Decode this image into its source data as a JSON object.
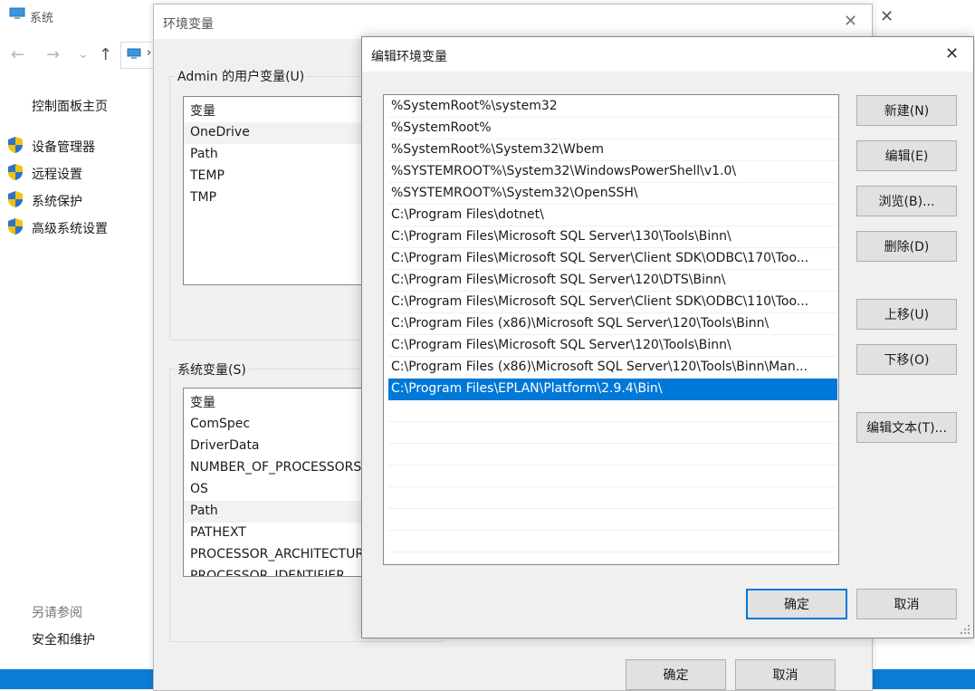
{
  "system_window": {
    "title": "系统",
    "control_panel_home": "控制面板主页",
    "links": [
      "设备管理器",
      "远程设置",
      "系统保护",
      "高级系统设置"
    ],
    "see_also": "另请参阅",
    "security_maintenance": "安全和维护",
    "nav_back": "←",
    "nav_forward": "→",
    "nav_recent": "⌄",
    "nav_up": "↑",
    "address_chevron": "›",
    "close_symbol": "✕"
  },
  "env_dialog": {
    "title": "环境变量",
    "close_symbol": "✕",
    "user_vars_label": "Admin 的用户变量(U)",
    "user_vars_header": "变量",
    "user_vars": [
      "OneDrive",
      "Path",
      "TEMP",
      "TMP"
    ],
    "system_vars_label": "系统变量(S)",
    "system_vars_header": "变量",
    "system_vars": [
      "ComSpec",
      "DriverData",
      "NUMBER_OF_PROCESSORS",
      "OS",
      "Path",
      "PATHEXT",
      "PROCESSOR_ARCHITECTURE",
      "PROCESSOR_IDENTIFIER"
    ],
    "ok_label": "确定",
    "cancel_label": "取消"
  },
  "edit_dialog": {
    "title": "编辑环境变量",
    "close_symbol": "✕",
    "paths": [
      "%SystemRoot%\\system32",
      "%SystemRoot%",
      "%SystemRoot%\\System32\\Wbem",
      "%SYSTEMROOT%\\System32\\WindowsPowerShell\\v1.0\\",
      "%SYSTEMROOT%\\System32\\OpenSSH\\",
      "C:\\Program Files\\dotnet\\",
      "C:\\Program Files\\Microsoft SQL Server\\130\\Tools\\Binn\\",
      "C:\\Program Files\\Microsoft SQL Server\\Client SDK\\ODBC\\170\\Too...",
      "C:\\Program Files\\Microsoft SQL Server\\120\\DTS\\Binn\\",
      "C:\\Program Files\\Microsoft SQL Server\\Client SDK\\ODBC\\110\\Too...",
      "C:\\Program Files (x86)\\Microsoft SQL Server\\120\\Tools\\Binn\\",
      "C:\\Program Files\\Microsoft SQL Server\\120\\Tools\\Binn\\",
      "C:\\Program Files (x86)\\Microsoft SQL Server\\120\\Tools\\Binn\\Man...",
      "C:\\Program Files\\EPLAN\\Platform\\2.9.4\\Bin\\"
    ],
    "selected_index": 13,
    "buttons": {
      "new": "新建(N)",
      "edit": "编辑(E)",
      "browse": "浏览(B)...",
      "delete": "删除(D)",
      "move_up": "上移(U)",
      "move_down": "下移(O)",
      "edit_text": "编辑文本(T)..."
    },
    "ok_label": "确定",
    "cancel_label": "取消"
  },
  "colors": {
    "selection": "#0078d7",
    "taskbar": "#0c7bd6",
    "dialog_bg": "#f0f0f0"
  }
}
